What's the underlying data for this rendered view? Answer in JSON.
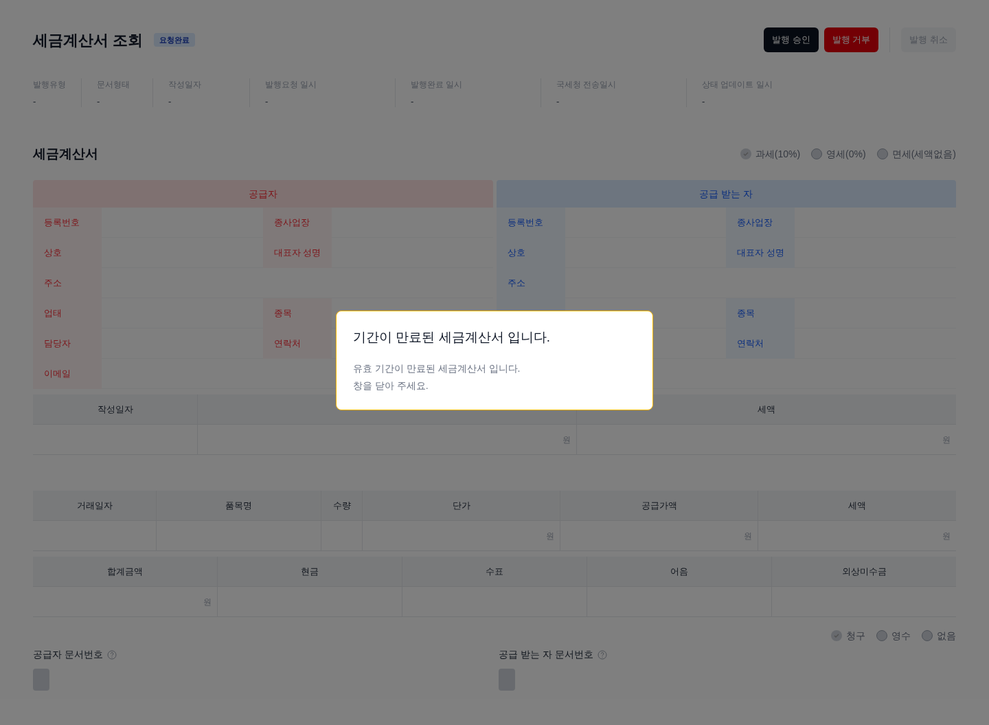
{
  "title": "세금계산서 조회",
  "status_badge": "요청완료",
  "buttons": [
    {
      "label": "발행 승인",
      "kind": "primary"
    },
    {
      "label": "발행 거부",
      "kind": "danger"
    },
    {
      "label": "발행 취소",
      "kind": "disabled"
    }
  ],
  "info_fields": [
    {
      "label": "발행유형",
      "value": "-"
    },
    {
      "label": "문서형태",
      "value": "-"
    },
    {
      "label": "작성일자",
      "value": "-"
    },
    {
      "label": "발행요청 일시",
      "value": "-"
    },
    {
      "label": "발행완료 일시",
      "value": "-"
    },
    {
      "label": "국세청 전송일시",
      "value": "-"
    },
    {
      "label": "상태 업데이트 일시",
      "value": "-"
    }
  ],
  "section_title": "세금계산서",
  "tax_types": [
    {
      "label": "과세(10%)",
      "selected": true
    },
    {
      "label": "영세(0%)",
      "selected": false
    },
    {
      "label": "면세(세액없음)",
      "selected": false
    }
  ],
  "supplier": {
    "title": "공급자",
    "rows": [
      [
        {
          "label": "등록번호"
        },
        {
          "label": "종사업장"
        }
      ],
      [
        {
          "label": "상호"
        },
        {
          "label": "대표자 성명"
        }
      ],
      [
        {
          "label": "주소"
        }
      ],
      [
        {
          "label": "업태"
        },
        {
          "label": "종목"
        }
      ],
      [
        {
          "label": "담당자"
        },
        {
          "label": "연락처"
        }
      ],
      [
        {
          "label": "이메일"
        }
      ]
    ]
  },
  "receiver": {
    "title": "공급 받는 자",
    "rows": [
      [
        {
          "label": "등록번호"
        },
        {
          "label": "종사업장"
        }
      ],
      [
        {
          "label": "상호"
        },
        {
          "label": "대표자 성명"
        }
      ],
      [
        {
          "label": "주소"
        }
      ],
      [
        {},
        {
          "label": "종목"
        }
      ],
      [
        {},
        {
          "label": "연락처"
        }
      ],
      [
        {}
      ]
    ]
  },
  "amount_table": {
    "columns": [
      {
        "label": "작성일자"
      },
      {
        "unit": "원"
      },
      {
        "label": "세액",
        "unit": "원"
      }
    ]
  },
  "items_table": {
    "columns": [
      {
        "label": "거래일자"
      },
      {
        "label": "품목명"
      },
      {
        "label": "수량"
      },
      {
        "label": "단가",
        "unit": "원"
      },
      {
        "label": "공급가액",
        "unit": "원"
      },
      {
        "label": "세액",
        "unit": "원"
      }
    ]
  },
  "payment_table": {
    "columns": [
      {
        "label": "합계금액",
        "unit": "원"
      },
      {
        "label": "현금"
      },
      {
        "label": "수표"
      },
      {
        "label": "어음"
      },
      {
        "label": "외상미수금"
      }
    ]
  },
  "receipt_types": [
    {
      "label": "청구",
      "selected": true
    },
    {
      "label": "영수",
      "selected": false
    },
    {
      "label": "없음",
      "selected": false
    }
  ],
  "doc_numbers": [
    {
      "label": "공급자 문서번호"
    },
    {
      "label": "공급 받는 자 문서번호"
    }
  ],
  "modal": {
    "title": "기간이 만료된 세금계산서 입니다.",
    "lines": [
      "유효 기간이 만료된 세금계산서 입니다.",
      "창을 닫아 주세요."
    ]
  }
}
